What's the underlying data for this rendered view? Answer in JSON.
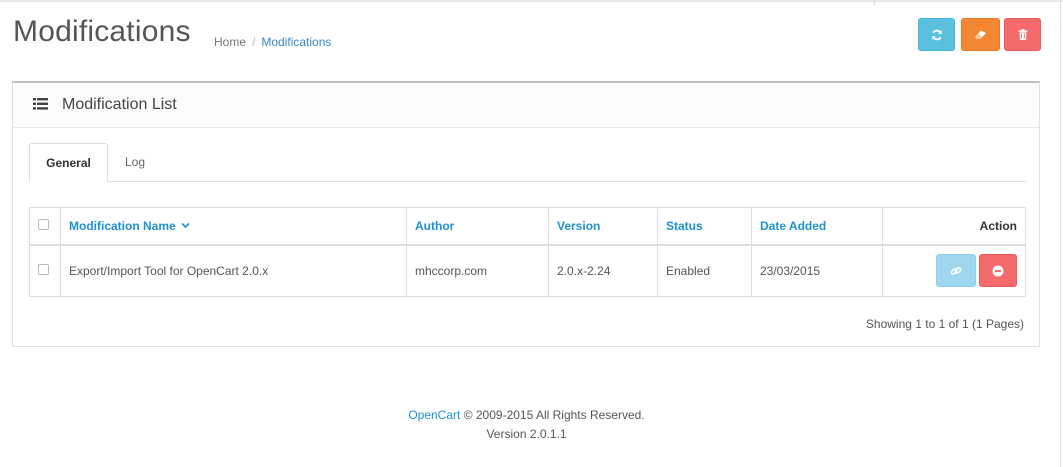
{
  "header": {
    "title": "Modifications",
    "breadcrumb": {
      "home": "Home",
      "separator": "/",
      "current": "Modifications"
    }
  },
  "toolbar": {
    "refresh_icon": "refresh-icon",
    "clear_icon": "eraser-icon",
    "delete_icon": "trash-icon",
    "colors": {
      "refresh": "#5bc0de",
      "clear": "#f38733",
      "delete": "#f56b6b"
    }
  },
  "panel": {
    "title": "Modification List",
    "icon": "list-icon"
  },
  "tabs": [
    {
      "label": "General",
      "active": true
    },
    {
      "label": "Log",
      "active": false
    }
  ],
  "table": {
    "columns": {
      "name": "Modification Name",
      "author": "Author",
      "version": "Version",
      "status": "Status",
      "date_added": "Date Added",
      "action": "Action"
    },
    "rows": [
      {
        "name": "Export/Import Tool for OpenCart 2.0.x",
        "author": "mhccorp.com",
        "version": "2.0.x-2.24",
        "status": "Enabled",
        "date_added": "23/03/2015"
      }
    ]
  },
  "pagination": {
    "info": "Showing 1 to 1 of 1 (1 Pages)"
  },
  "footer": {
    "brand": "OpenCart",
    "copyright": "© 2009-2015 All Rights Reserved.",
    "version": "Version 2.0.1.1"
  }
}
